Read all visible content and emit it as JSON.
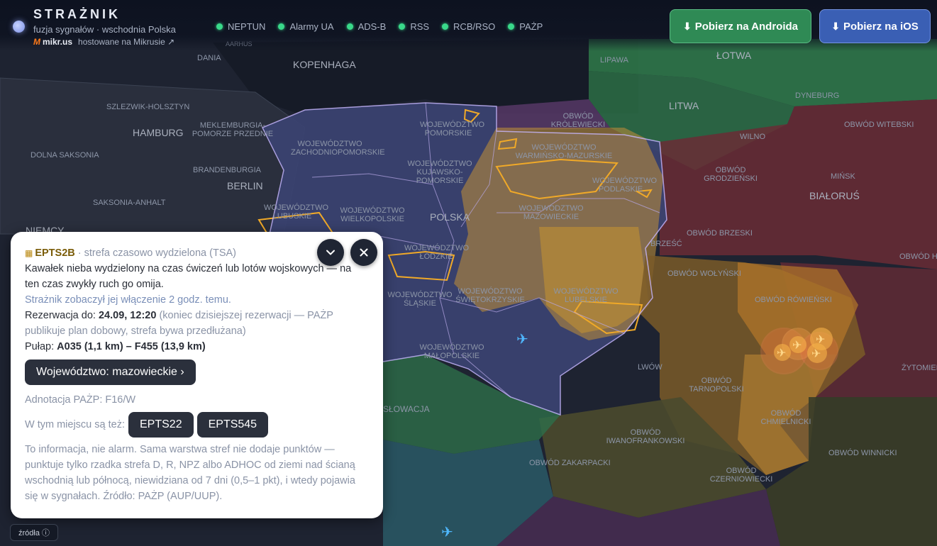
{
  "app": {
    "title": "STRAŻNIK",
    "subtitle": "fuzja sygnałów · wschodnia Polska",
    "host_logo": "M",
    "host_name": "mikr.us",
    "host_text": "hostowane na Mikrusie ↗"
  },
  "sources": [
    {
      "label": "NEPTUN",
      "status_color": "#39d98a"
    },
    {
      "label": "Alarmy UA",
      "status_color": "#39d98a"
    },
    {
      "label": "ADS-B",
      "status_color": "#39d98a"
    },
    {
      "label": "RSS",
      "status_color": "#39d98a"
    },
    {
      "label": "RCB/RSO",
      "status_color": "#39d98a"
    },
    {
      "label": "PAŻP",
      "status_color": "#39d98a"
    }
  ],
  "downloads": {
    "android": "Pobierz na Androida",
    "ios": "Pobierz na iOS",
    "icon": "download-arrow-icon"
  },
  "map": {
    "labels": [
      "DANIA",
      "AARHUS",
      "KOPENHAGA",
      "SZLEZWIK-HOLSZTYN",
      "HAMBURG",
      "MEKLEMBURGIA-POMORZE PRZEDNIE",
      "DOLNA SAKSONIA",
      "BRANDENBURGIA",
      "BERLIN",
      "SAKSONIA-ANHALT",
      "NIEMCY",
      "WOJEWÓDZTWO POMORSKIE",
      "WOJEWÓDZTWO ZACHODNIOPOMORSKIE",
      "WOJEWÓDZTWO KUJAWSKO-POMORSKIE",
      "WOJEWÓDZTWO WARMIŃSKO-MAZURSKIE",
      "WOJEWÓDZTWO PODLASKIE",
      "WOJEWÓDZTWO MAZOWIECKIE",
      "WOJEWÓDZTWO LUBUSKIE",
      "WOJEWÓDZTWO WIELKOPOLSKIE",
      "POLSKA",
      "WOJEWÓDZTWO ŁÓDZKIE",
      "WOJEWÓDZTWO ŚWIĘTOKRZYSKIE",
      "WOJEWÓDZTWO LUBELSKIE",
      "WOJEWÓDZTWO ŚLĄSKIE",
      "WOJEWÓDZTWO MAŁOPOLSKIE",
      "ŁOTWA",
      "LIPAWA",
      "DYNEBURG",
      "LITWA",
      "OBWÓD KRÓLEWIECKI",
      "WILNO",
      "OBWÓD GRODZIEŃSKI",
      "OBWÓD WITEBSKI",
      "MIŃSK",
      "BIAŁORUŚ",
      "OBWÓD BRZESKI",
      "OBWÓD HOMELSKI",
      "BRZEŚĆ",
      "OBWÓD WOŁYŃSKI",
      "OBWÓD RÓWIEŃSKI",
      "ŻYTOMIERZ",
      "LWÓW",
      "OBWÓD TARNOPOLSKI",
      "OBWÓD CHMIELNICKI",
      "OBWÓD IWANOFRANKOWSKI",
      "OBWÓD ZAKARPACKI",
      "OBWÓD CZERNIOWIECKI",
      "OBWÓD WINNICKI",
      "SŁOWACJA"
    ]
  },
  "panel": {
    "zone_icon": "▦",
    "zone_id": "EPTS2B",
    "zone_type": "· strefa czasowo wydzielona (TSA)",
    "description": "Kawałek nieba wydzielony na czas ćwiczeń lub lotów wojskowych — na ten czas zwykły ruch go omija.",
    "seen": "Strażnik zobaczył jej włączenie 2 godz. temu.",
    "reservation_label": "Rezerwacja do:",
    "reservation_value": "24.09, 12:20",
    "reservation_note": "(koniec dzisiejszej rezerwacji — PAŻP publikuje plan dobowy, strefa bywa przedłużana)",
    "ceiling_label": "Pułap:",
    "ceiling_value": "A035 (1,1 km) – F455 (13,9 km)",
    "voivodeship_button": "Województwo: mazowieckie ›",
    "annotation": "Adnotacja PAŻP: F16/W",
    "also_label": "W tym miejscu są też:",
    "also_zones": [
      "EPTS22",
      "EPTS545"
    ],
    "footer": "To informacja, nie alarm. Sama warstwa stref nie dodaje punktów — punktuje tylko rzadka strefa D, R, NPZ albo ADHOC od ziemi nad ścianą wschodnią lub północą, niewidziana od 7 dni (0,5–1 pkt), i wtedy pojawia się w sygnałach. Źródło: PAŻP (AUP/UUP)."
  },
  "controls": {
    "collapse_icon": "chevron-down-icon",
    "close_icon": "close-icon",
    "sources_button": "źródła ⓘ"
  }
}
